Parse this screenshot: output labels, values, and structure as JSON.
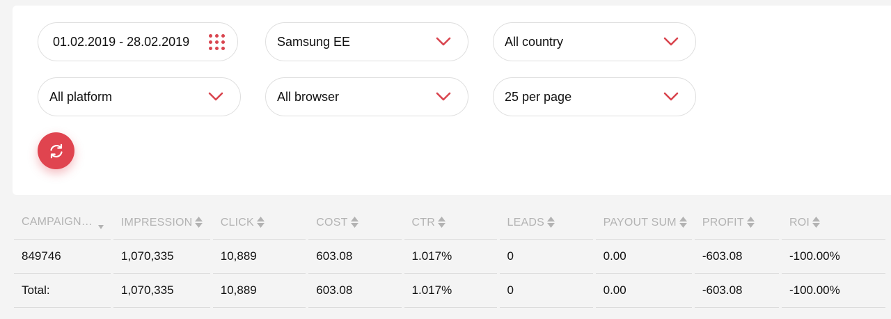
{
  "filters": {
    "date_range": "01.02.2019 - 28.02.2019",
    "campaign": "Samsung EE",
    "country": "All country",
    "platform": "All platform",
    "browser": "All browser",
    "per_page": "25 per page"
  },
  "colors": {
    "accent": "#e0444f",
    "header_text": "#b3b3b3"
  },
  "table": {
    "columns": [
      "CAMPAIGN…",
      "IMPRESSION",
      "CLICK",
      "COST",
      "CTR",
      "LEADS",
      "PAYOUT SUM",
      "PROFIT",
      "ROI"
    ],
    "rows": [
      [
        "849746",
        "1,070,335",
        "10,889",
        "603.08",
        "1.017%",
        "0",
        "0.00",
        "-603.08",
        "-100.00%"
      ],
      [
        "Total:",
        "1,070,335",
        "10,889",
        "603.08",
        "1.017%",
        "0",
        "0.00",
        "-603.08",
        "-100.00%"
      ]
    ]
  }
}
